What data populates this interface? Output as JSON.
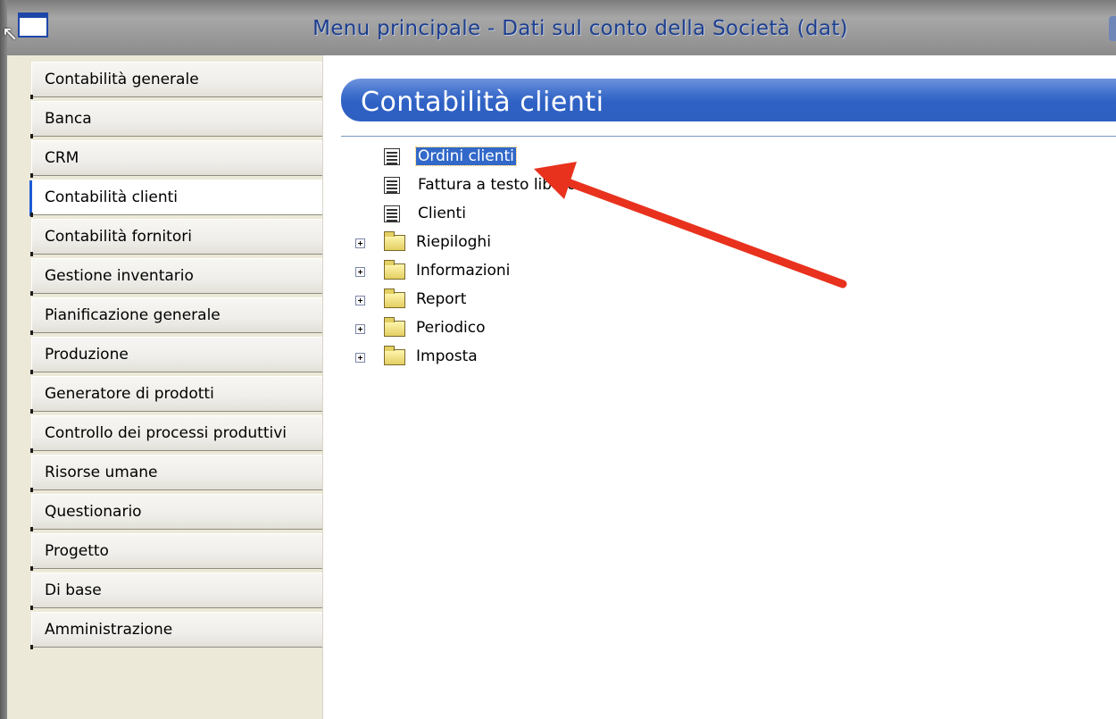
{
  "window": {
    "title": "Menu principale  -  Dati sul conto della Società (dat)"
  },
  "sidebar": {
    "items": [
      {
        "label": "Contabilità generale"
      },
      {
        "label": "Banca"
      },
      {
        "label": "CRM"
      },
      {
        "label": "Contabilità clienti",
        "active": true
      },
      {
        "label": "Contabilità fornitori"
      },
      {
        "label": "Gestione inventario"
      },
      {
        "label": "Pianificazione generale"
      },
      {
        "label": "Produzione"
      },
      {
        "label": "Generatore di prodotti"
      },
      {
        "label": "Controllo dei processi produttivi"
      },
      {
        "label": "Risorse umane"
      },
      {
        "label": "Questionario"
      },
      {
        "label": "Progetto"
      },
      {
        "label": "Di base"
      },
      {
        "label": "Amministrazione"
      }
    ]
  },
  "content": {
    "section_title": "Contabilità clienti",
    "tree": {
      "items": [
        {
          "label": "Ordini clienti",
          "icon": "document-icon",
          "selected": true
        },
        {
          "label": "Fattura a testo libero",
          "icon": "document-icon"
        },
        {
          "label": "Clienti",
          "icon": "document-icon"
        },
        {
          "label": "Riepiloghi",
          "icon": "folder-icon"
        },
        {
          "label": "Informazioni",
          "icon": "folder-icon"
        },
        {
          "label": "Report",
          "icon": "folder-icon"
        },
        {
          "label": "Periodico",
          "icon": "folder-icon"
        },
        {
          "label": "Imposta",
          "icon": "folder-icon"
        }
      ]
    }
  },
  "colors": {
    "title_text": "#1d3f8f",
    "header_blue": "#2f61c4",
    "selection": "#3168c9",
    "annotation_arrow": "#e8321e"
  }
}
